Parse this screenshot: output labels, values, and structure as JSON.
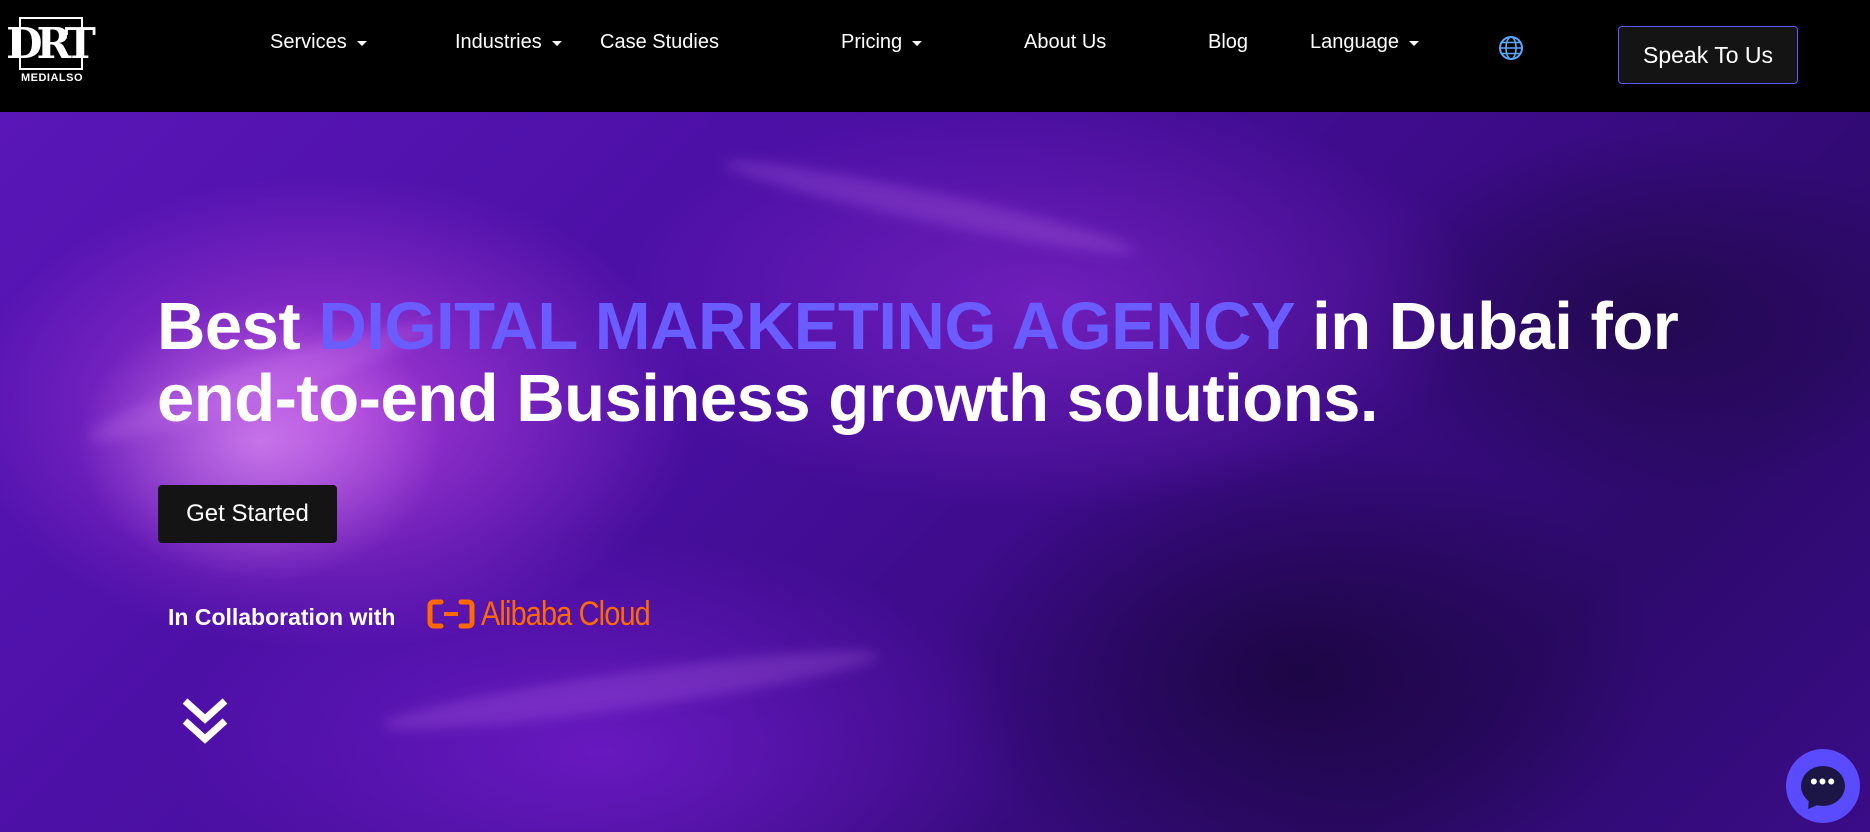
{
  "brand": {
    "logo_mark": "DRT",
    "logo_text": "MEDIALSO"
  },
  "nav": {
    "items": [
      {
        "label": "Services",
        "has_dropdown": true
      },
      {
        "label": "Industries",
        "has_dropdown": true
      },
      {
        "label": "Case Studies",
        "has_dropdown": false
      },
      {
        "label": "Pricing",
        "has_dropdown": true
      },
      {
        "label": "About Us",
        "has_dropdown": false
      },
      {
        "label": "Blog",
        "has_dropdown": false
      },
      {
        "label": "Language",
        "has_dropdown": true
      }
    ],
    "globe_icon": "globe-icon",
    "cta_label": "Speak To Us"
  },
  "hero": {
    "title_pre": "Best ",
    "title_accent": "DIGITAL MARKETING AGENCY",
    "title_post": " in Dubai for end-to-end Business growth solutions.",
    "cta_label": "Get Started",
    "collab_label": "In Collaboration with",
    "partner_name": "Alibaba Cloud",
    "scroll_icon": "double-chevron-down-icon"
  },
  "chat": {
    "icon": "chat-bubble-icon"
  },
  "colors": {
    "nav_bg": "#000000",
    "accent": "#6a5cff",
    "button_bg": "#141414",
    "partner_orange": "#ff6a00",
    "chat_bg": "#5b4bff"
  }
}
